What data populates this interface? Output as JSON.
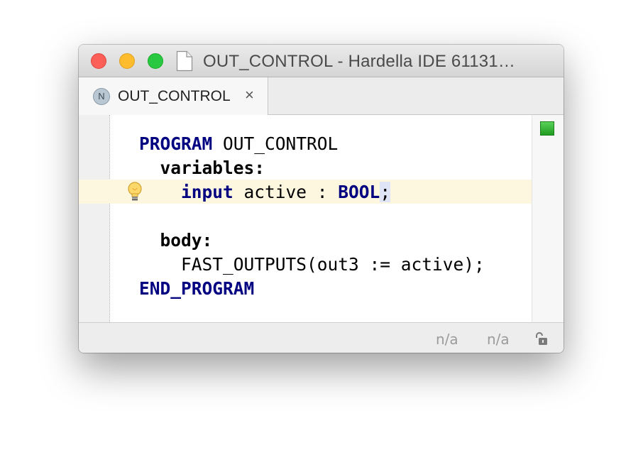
{
  "window": {
    "title": "OUT_CONTROL - Hardella IDE 61131…"
  },
  "tabs": [
    {
      "icon_letter": "N",
      "label": "OUT_CONTROL",
      "close_glyph": "×"
    }
  ],
  "editor": {
    "lines": {
      "l1_kw": "PROGRAM",
      "l1_rest": " OUT_CONTROL",
      "l2_kw": "variables:",
      "l3_kw": "input",
      "l3_mid": " active : ",
      "l3_type": "BOOL",
      "l3_semi": ";",
      "l5_kw": "body:",
      "l6_text": "FAST_OUTPUTS(out3 := active);",
      "l7_kw": "END_PROGRAM"
    },
    "status_mark_color": "#2fb52f",
    "intention_icon": "lightbulb-icon"
  },
  "statusbar": {
    "position_a": "n/a",
    "position_b": "n/a",
    "lock_icon": "unlocked-padlock-icon"
  },
  "colors": {
    "keyword": "#000080",
    "current_line": "#fdf7df",
    "traffic_close": "#fc5f57",
    "traffic_min": "#fdbc2e",
    "traffic_max": "#28c840"
  }
}
